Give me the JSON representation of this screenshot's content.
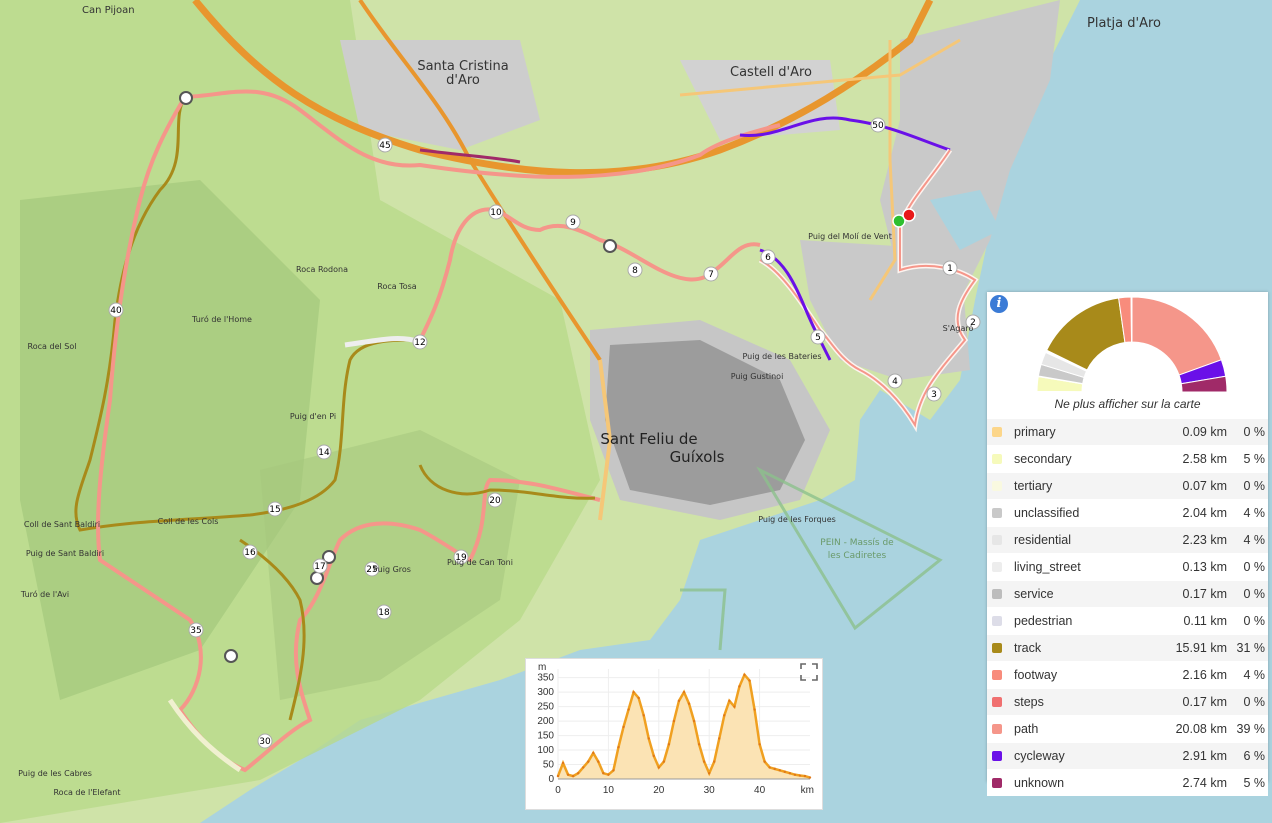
{
  "map": {
    "places": [
      {
        "name": "Can Pijoan"
      },
      {
        "name": "Santa Cristina"
      },
      {
        "name": "d'Aro"
      },
      {
        "name": "Castell d'Aro"
      },
      {
        "name": "Platja d'Aro"
      },
      {
        "name": "Sant Feliu de"
      },
      {
        "name": "Guíxols"
      },
      {
        "name": "Roca Rodona"
      },
      {
        "name": "Roca Tosa"
      },
      {
        "name": "Turó de l'Home"
      },
      {
        "name": "Roca del Sol"
      },
      {
        "name": "Puig d'en Pi"
      },
      {
        "name": "Coll de Sant Baldiri"
      },
      {
        "name": "Puig de Sant Baldiri"
      },
      {
        "name": "Turó de l'Avi"
      },
      {
        "name": "Puig de les Cabres"
      },
      {
        "name": "Roca de l'Elefant"
      },
      {
        "name": "Puig del Molí de Vent"
      },
      {
        "name": "Puig de les Bateries"
      },
      {
        "name": "Puig Gustinoi"
      },
      {
        "name": "Puig de les Forques"
      },
      {
        "name": "PEIN - Massís de"
      },
      {
        "name": "les Cadiretes"
      },
      {
        "name": "S'Agaró"
      },
      {
        "name": "Puig de Can Toni"
      },
      {
        "name": "Puig Gros"
      },
      {
        "name": "Coll de les Cols"
      }
    ],
    "km_markers": [
      "1",
      "2",
      "3",
      "4",
      "5",
      "6",
      "7",
      "8",
      "9",
      "10",
      "12",
      "14",
      "15",
      "16",
      "17",
      "18",
      "19",
      "20",
      "25",
      "30",
      "35",
      "40",
      "45",
      "50"
    ]
  },
  "panel": {
    "info_icon": "info-icon",
    "hide_label": "Ne plus afficher sur la carte",
    "rows": [
      {
        "name": "primary",
        "km": "0.09 km",
        "pct": "0 %",
        "color": "#fcd68a",
        "frac": 0.002
      },
      {
        "name": "secondary",
        "km": "2.58 km",
        "pct": "5 %",
        "color": "#f6fabb",
        "frac": 0.05
      },
      {
        "name": "tertiary",
        "km": "0.07 km",
        "pct": "0 %",
        "color": "#f9f9e0",
        "frac": 0.002
      },
      {
        "name": "unclassified",
        "km": "2.04 km",
        "pct": "4 %",
        "color": "#c9c9c9",
        "frac": 0.04
      },
      {
        "name": "residential",
        "km": "2.23 km",
        "pct": "4 %",
        "color": "#e6e6e6",
        "frac": 0.043
      },
      {
        "name": "living_street",
        "km": "0.13 km",
        "pct": "0 %",
        "color": "#ededed",
        "frac": 0.003
      },
      {
        "name": "service",
        "km": "0.17 km",
        "pct": "0 %",
        "color": "#bdbdbd",
        "frac": 0.003
      },
      {
        "name": "pedestrian",
        "km": "0.11 km",
        "pct": "0 %",
        "color": "#dddde8",
        "frac": 0.002
      },
      {
        "name": "track",
        "km": "15.91 km",
        "pct": "31 %",
        "color": "#a88a1a",
        "frac": 0.31
      },
      {
        "name": "footway",
        "km": "2.16 km",
        "pct": "4 %",
        "color": "#f88c7c",
        "frac": 0.042
      },
      {
        "name": "steps",
        "km": "0.17 km",
        "pct": "0 %",
        "color": "#f07070",
        "frac": 0.003
      },
      {
        "name": "path",
        "km": "20.08 km",
        "pct": "39 %",
        "color": "#f5968a",
        "frac": 0.39
      },
      {
        "name": "cycleway",
        "km": "2.91 km",
        "pct": "6 %",
        "color": "#6a10e8",
        "frac": 0.057
      },
      {
        "name": "unknown",
        "km": "2.74 km",
        "pct": "5 %",
        "color": "#a02a68",
        "frac": 0.053
      }
    ]
  },
  "chart_data": {
    "type": "area",
    "ylabel": "m",
    "xlabel": "km",
    "yticks": [
      "0",
      "50",
      "100",
      "150",
      "200",
      "250",
      "300",
      "350"
    ],
    "xticks": [
      "0",
      "10",
      "20",
      "30",
      "40"
    ],
    "ylim": [
      0,
      380
    ],
    "xlim": [
      0,
      50
    ],
    "x": [
      0,
      1,
      2,
      3,
      4,
      5,
      6,
      7,
      8,
      9,
      10,
      11,
      12,
      13,
      14,
      15,
      16,
      17,
      18,
      19,
      20,
      21,
      22,
      23,
      24,
      25,
      26,
      27,
      28,
      29,
      30,
      31,
      32,
      33,
      34,
      35,
      36,
      37,
      38,
      39,
      40,
      41,
      42,
      43,
      44,
      45,
      46,
      47,
      48,
      49,
      50
    ],
    "y": [
      10,
      55,
      15,
      10,
      20,
      40,
      60,
      90,
      60,
      20,
      15,
      30,
      110,
      180,
      240,
      300,
      280,
      220,
      140,
      80,
      40,
      60,
      120,
      200,
      270,
      300,
      260,
      200,
      120,
      60,
      20,
      60,
      140,
      220,
      270,
      250,
      320,
      360,
      340,
      240,
      120,
      60,
      40,
      35,
      30,
      25,
      20,
      15,
      12,
      10,
      5
    ],
    "expand_icon": "expand-icon"
  }
}
